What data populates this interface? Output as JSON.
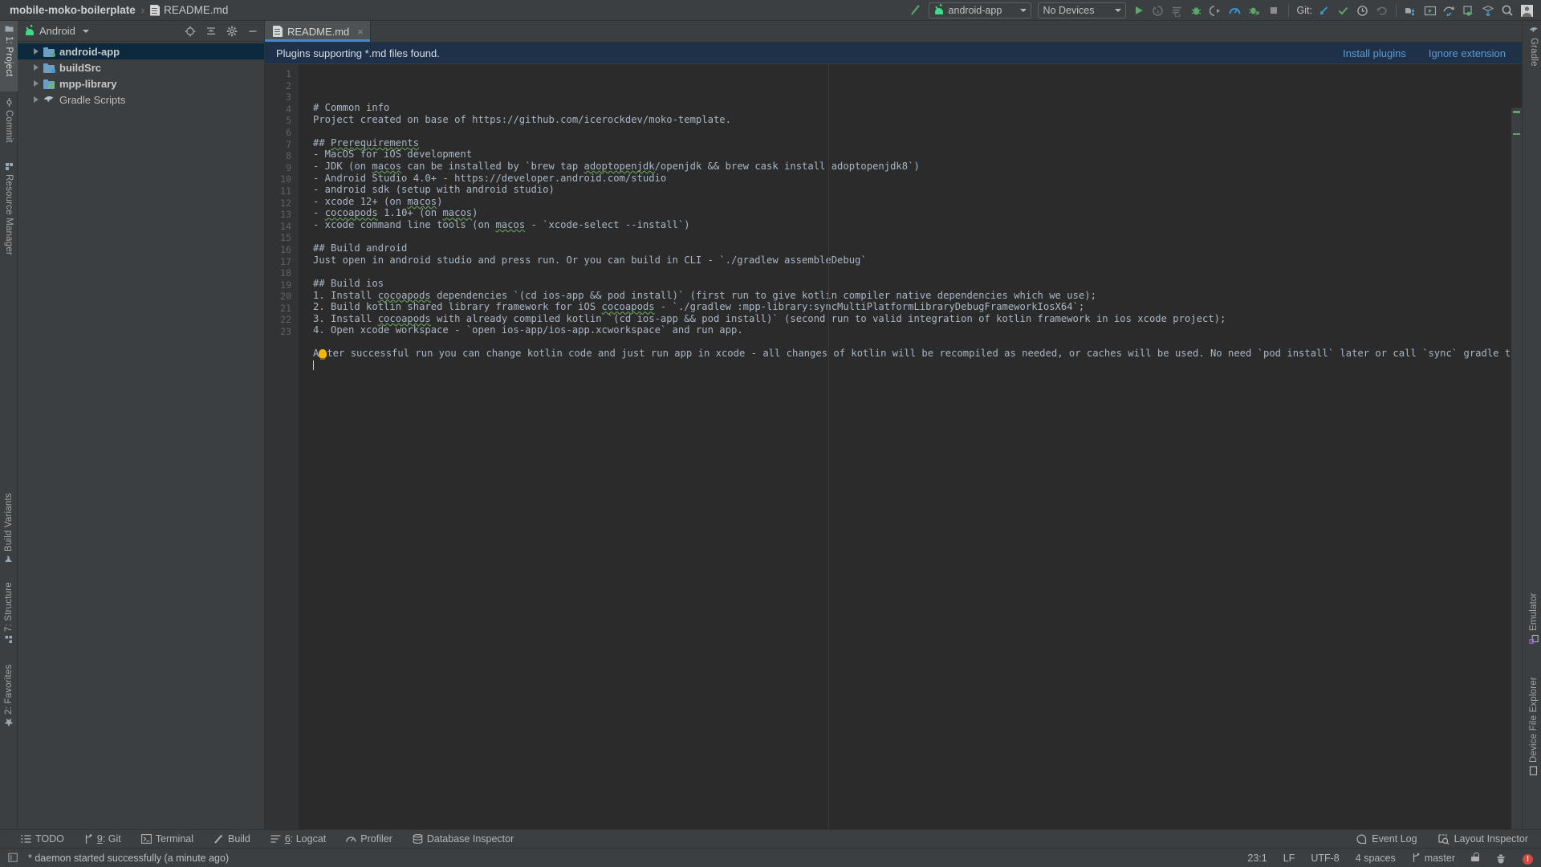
{
  "titlebar": {
    "project_name": "mobile-moko-boilerplate",
    "separator": "›",
    "file_name": "README.md",
    "file_icon": "markdown-file-icon"
  },
  "toolbar": {
    "build_icon": "build-hammer-icon",
    "run_config": {
      "label": "android-app",
      "icon": "android-robot-icon"
    },
    "device_selector": {
      "label": "No Devices"
    },
    "actions": [
      {
        "name": "run-button",
        "icon": "play-triangle-icon",
        "color": "#59a869"
      },
      {
        "name": "apply-changes-button",
        "icon": "apply-changes-icon",
        "color": "#6e6e6e"
      },
      {
        "name": "apply-code-changes-button",
        "icon": "apply-code-changes-icon",
        "color": "#6e6e6e"
      },
      {
        "name": "debug-button",
        "icon": "bug-icon",
        "color": "#59a869"
      },
      {
        "name": "attach-debugger-button",
        "icon": "attach-debugger-icon",
        "color": "#9a9a9a"
      },
      {
        "name": "profiler-button",
        "icon": "profiler-gauge-icon",
        "color": "#389fd6"
      },
      {
        "name": "run-coverage-button",
        "icon": "coverage-bug-icon",
        "color": "#59a869"
      },
      {
        "name": "stop-button",
        "icon": "stop-square-icon",
        "color": "#8c8c8c"
      }
    ],
    "git_label": "Git:",
    "git_actions": [
      {
        "name": "update-project-button",
        "icon": "arrow-down-left-icon",
        "color": "#389fd6"
      },
      {
        "name": "commit-button",
        "icon": "checkmark-icon",
        "color": "#59a869"
      },
      {
        "name": "history-button",
        "icon": "clock-icon",
        "color": "#b0b0b0"
      },
      {
        "name": "rollback-button",
        "icon": "undo-arrow-icon",
        "color": "#6e6e6e"
      }
    ],
    "right_actions": [
      {
        "name": "avd-manager-button",
        "icon": "avd-manager-icon",
        "color": "#389fd6"
      },
      {
        "name": "layout-editor-button",
        "icon": "layout-editor-icon",
        "color": "#59a869"
      },
      {
        "name": "sync-gradle-button",
        "icon": "gradle-sync-icon",
        "color": "#389fd6"
      },
      {
        "name": "sdk-manager-button",
        "icon": "sdk-manager-icon",
        "color": "#59a869"
      },
      {
        "name": "project-structure-button",
        "icon": "project-structure-icon",
        "color": "#389fd6"
      },
      {
        "name": "search-everywhere-button",
        "icon": "search-icon",
        "color": "#b0b0b0"
      },
      {
        "name": "account-button",
        "icon": "user-avatar-icon",
        "color": "#cccccc"
      }
    ]
  },
  "left_stripe": {
    "top_items": [
      {
        "label": "1: Project",
        "icon": "project-folder-icon",
        "active": true
      },
      {
        "label": "Commit",
        "icon": "commit-icon",
        "active": false
      },
      {
        "label": "Resource Manager",
        "icon": "resource-manager-icon",
        "active": false
      }
    ],
    "bottom_items": [
      {
        "label": "Build Variants",
        "icon": "build-variants-icon"
      },
      {
        "label": "7: Structure",
        "icon": "structure-icon"
      },
      {
        "label": "2: Favorites",
        "icon": "star-icon"
      }
    ]
  },
  "right_stripe": {
    "top_items": [
      {
        "label": "Gradle",
        "icon": "gradle-elephant-icon"
      }
    ],
    "bottom_items": [
      {
        "label": "Emulator",
        "icon": "emulator-icon"
      },
      {
        "label": "Device File Explorer",
        "icon": "device-file-explorer-icon"
      }
    ]
  },
  "project_panel": {
    "title": "Android",
    "title_icon": "android-robot-icon",
    "header_buttons": [
      {
        "name": "select-opened-file-button",
        "icon": "crosshair-target-icon"
      },
      {
        "name": "collapse-all-button",
        "icon": "collapse-all-icon"
      },
      {
        "name": "settings-button",
        "icon": "gear-icon"
      },
      {
        "name": "hide-button",
        "icon": "minimize-icon"
      }
    ],
    "tree": [
      {
        "label": "android-app",
        "icon": "module-folder-icon",
        "badge": "#59a869",
        "badge_shape": "circle",
        "selected": true,
        "bold": true
      },
      {
        "label": "buildSrc",
        "icon": "module-folder-icon",
        "badge": "#389fd6",
        "badge_shape": "square",
        "selected": false,
        "bold": true
      },
      {
        "label": "mpp-library",
        "icon": "library-module-icon",
        "badge": "",
        "badge_shape": "bars",
        "selected": false,
        "bold": true
      },
      {
        "label": "Gradle Scripts",
        "icon": "gradle-elephant-icon",
        "badge": "",
        "badge_shape": "none",
        "selected": false,
        "bold": false
      }
    ]
  },
  "editor": {
    "tabs": [
      {
        "label": "README.md",
        "icon": "markdown-file-icon",
        "close_label": "×",
        "active": true
      }
    ],
    "notification": {
      "message": "Plugins supporting *.md files found.",
      "install_link": "Install plugins",
      "ignore_link": "Ignore extension"
    },
    "line_numbers": [
      1,
      2,
      3,
      4,
      5,
      6,
      7,
      8,
      9,
      10,
      11,
      12,
      13,
      14,
      15,
      16,
      17,
      18,
      19,
      20,
      21,
      22,
      23
    ],
    "lines": [
      "# Common info",
      "Project created on base of https://github.com/icerockdev/moko-template.",
      "",
      "## Prerequirements",
      "- MacOS for iOS development",
      "- JDK (on macos can be installed by `brew tap adoptopenjdk/openjdk && brew cask install adoptopenjdk8`)",
      "- Android Studio 4.0+ - https://developer.android.com/studio",
      "- android sdk (setup with android studio)",
      "- xcode 12+ (on macos)",
      "- cocoapods 1.10+ (on macos)",
      "- xcode command line tools (on macos - `xcode-select --install`)",
      "",
      "## Build android",
      "Just open in android studio and press run. Or you can build in CLI - `./gradlew assembleDebug`",
      "",
      "## Build ios",
      "1. Install cocoapods dependencies `(cd ios-app && pod install)` (first run to give kotlin compiler native dependencies which we use);",
      "2. Build kotlin shared library framework for iOS cocoapods - `./gradlew :mpp-library:syncMultiPlatformLibraryDebugFrameworkIosX64`;",
      "3. Install cocoapods with already compiled kotlin `(cd ios-app && pod install)` (second run to valid integration of kotlin framework in ios xcode project);",
      "4. Open xcode workspace - `open ios-app/ios-app.xcworkspace` and run app.",
      "",
      "After successful run you can change kotlin code and just run app in xcode - all changes of kotlin will be recompiled as needed, or caches will be used. No need `pod install` later or call `sync` gradle task.",
      ""
    ]
  },
  "bottom_bar": {
    "items": [
      {
        "label": "TODO",
        "icon": "todo-list-icon",
        "shortcut": ""
      },
      {
        "label": "Git",
        "icon": "git-branch-icon",
        "shortcut": "9"
      },
      {
        "label": "Terminal",
        "icon": "terminal-icon",
        "shortcut": ""
      },
      {
        "label": "Build",
        "icon": "build-hammer-icon",
        "shortcut": ""
      },
      {
        "label": "Logcat",
        "icon": "logcat-icon",
        "shortcut": "6"
      },
      {
        "label": "Profiler",
        "icon": "profiler-gauge-icon",
        "shortcut": ""
      },
      {
        "label": "Database Inspector",
        "icon": "database-icon",
        "shortcut": ""
      }
    ],
    "right_items": [
      {
        "label": "Event Log",
        "icon": "event-log-icon"
      },
      {
        "label": "Layout Inspector",
        "icon": "layout-inspector-icon"
      }
    ]
  },
  "status_bar": {
    "message": "* daemon started successfully (a minute ago)",
    "message_icon": "console-icon",
    "caret_position": "23:1",
    "line_separator": "LF",
    "encoding": "UTF-8",
    "indent": "4 spaces",
    "branch": "master",
    "branch_icon": "git-branch-icon",
    "lock_icon": "read-only-lock-icon",
    "inspection_icon": "inspection-hector-icon",
    "error_icon": "error-badge-icon"
  }
}
